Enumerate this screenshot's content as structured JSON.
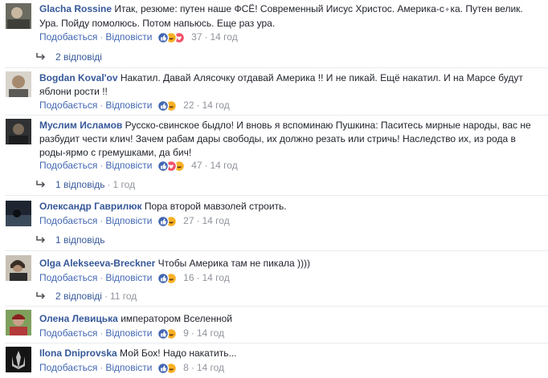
{
  "comments": [
    {
      "name": "Glacha Rossine",
      "text": "Итак, резюме: путен наше ФСЁ! Современный Иисус Христос. Америка-с",
      "text_mark": "✦",
      "text_rest": "ка. Путен велик.",
      "text2": "Ура. Пойду помолюсь. Потом напьюсь. Еще раз ура.",
      "like": "Подобається",
      "reply": "Відповісти",
      "reactions": [
        "like",
        "haha",
        "love"
      ],
      "count": "37",
      "time": "14 год",
      "replies": "2 відповіді"
    },
    {
      "name": "Bogdan Koval'ov",
      "text": "Накатил. Давай Алясочку отдавай Америка !! И не пикай. Ещё накатил. И на Марсе будут",
      "text2": "яблони рости !!",
      "like": "Подобається",
      "reply": "Відповісти",
      "reactions": [
        "like",
        "haha"
      ],
      "count": "22",
      "time": "14 год"
    },
    {
      "name": "Муслим Исламов",
      "text": "Русско-свинское быдло! И вновь я вспоминаю Пушкина: Паситесь мирные народы, вас не",
      "text2": "разбудит чести клич! Зачем рабам дары свободы, их должно резать или стричь! Наследство их, из рода в",
      "text3": "роды-ярмо с гремушками, да бич!",
      "like": "Подобається",
      "reply": "Відповісти",
      "reactions": [
        "like",
        "love",
        "haha"
      ],
      "count": "47",
      "time": "14 год",
      "replies": "1 відповідь",
      "replies_time": "1 год"
    },
    {
      "name": "Олександр Гаврилюк",
      "text": "Пора второй мавзолей строить.",
      "like": "Подобається",
      "reply": "Відповісти",
      "reactions": [
        "like",
        "haha"
      ],
      "count": "27",
      "time": "14 год",
      "replies": "1 відповідь"
    },
    {
      "name": "Olga Alekseeva-Breckner",
      "text": "Чтобы Америка там не пикала ))))",
      "like": "Подобається",
      "reply": "Відповісти",
      "reactions": [
        "like",
        "haha"
      ],
      "count": "16",
      "time": "14 год",
      "replies": "2 відповіді",
      "replies_time": "11 год"
    },
    {
      "name": "Олена Левицька",
      "text": "императором Вселенной",
      "like": "Подобається",
      "reply": "Відповісти",
      "reactions": [
        "like",
        "haha"
      ],
      "count": "9",
      "time": "14 год"
    },
    {
      "name": "Ilona Dniprovska",
      "text": "Мой Бох! Надо накатить...",
      "like": "Подобається",
      "reply": "Відповісти",
      "reactions": [
        "like",
        "haha"
      ],
      "count": "8",
      "time": "14 год"
    }
  ],
  "colors": {
    "name": "#365899",
    "link": "#4267b2",
    "meta": "#90949c",
    "like": "#4267b2",
    "haha": "#f7b125",
    "love": "#f25268"
  }
}
